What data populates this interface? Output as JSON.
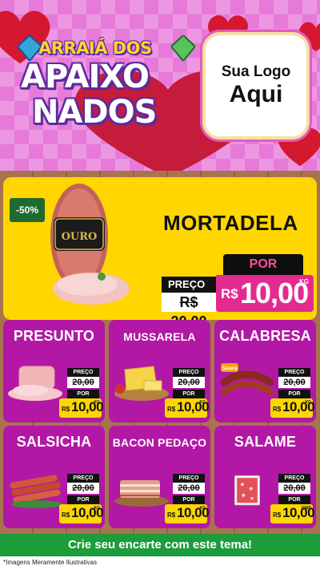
{
  "header": {
    "title_line1": "ARRAIÁ DOS",
    "title_line2": "APAIXO",
    "title_line3": "NADOS",
    "logo_line1": "Sua Logo",
    "logo_line2": "Aqui"
  },
  "feature": {
    "discount": "-50%",
    "name": "MORTADELA",
    "por_label": "POR",
    "preco_label": "PREÇO",
    "old_price": "R$ 20,00",
    "currency": "R$",
    "new_price": "10,00",
    "unit": "KG",
    "brand_label": "OURO"
  },
  "products": [
    {
      "name": "PRESUNTO",
      "preco_label": "PREÇO",
      "old_price": "20,00",
      "por_label": "POR",
      "currency": "R$",
      "new_price": "10,00",
      "unit": "KG"
    },
    {
      "name": "MUSSARELA",
      "preco_label": "PREÇO",
      "old_price": "20,00",
      "por_label": "POR",
      "currency": "R$",
      "new_price": "10,00",
      "unit": "KG"
    },
    {
      "name": "CALABRESA",
      "preco_label": "PREÇO",
      "old_price": "20,00",
      "por_label": "POR",
      "currency": "R$",
      "new_price": "10,00",
      "unit": "KG",
      "brand_label": "Seara"
    },
    {
      "name": "SALSICHA",
      "preco_label": "PREÇO",
      "old_price": "20,00",
      "por_label": "POR",
      "currency": "R$",
      "new_price": "10,00",
      "unit": "KG"
    },
    {
      "name": "BACON PEDAÇO",
      "preco_label": "PREÇO",
      "old_price": "20,00",
      "por_label": "POR",
      "currency": "R$",
      "new_price": "10,00",
      "unit": "KG"
    },
    {
      "name": "SALAME",
      "preco_label": "PREÇO",
      "old_price": "20,00",
      "por_label": "POR",
      "currency": "R$",
      "new_price": "10,00",
      "unit": "UNID"
    }
  ],
  "cta_label": "Crie seu encarte com este tema!",
  "disclaimer": "*Imagens Meramente Ilustrativas",
  "colors": {
    "header_pink": "#e77ad9",
    "card_purple": "#b218a5",
    "feature_yellow": "#ffd600",
    "price_pink": "#e22a8f",
    "cta_green": "#1c9c3a",
    "discount_green": "#1f6a2e"
  }
}
